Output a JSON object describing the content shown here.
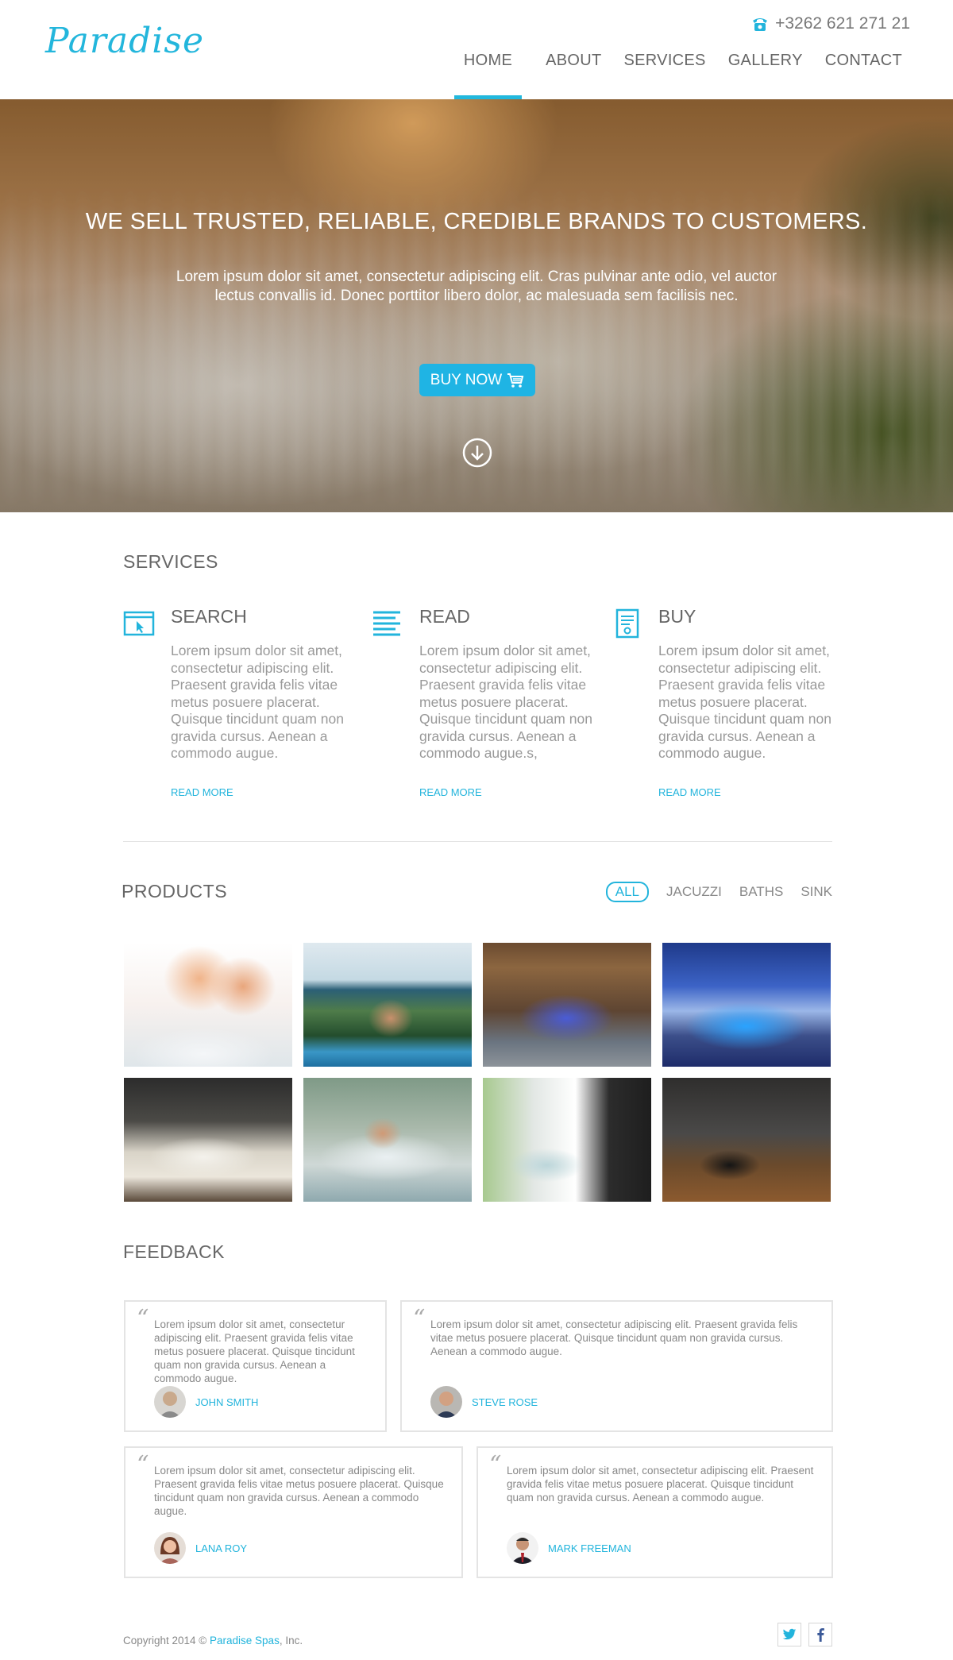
{
  "header": {
    "logo": "Paradise",
    "phone": "+3262 621 271 21",
    "nav": [
      "HOME",
      "ABOUT",
      "SERVICES",
      "GALLERY",
      "CONTACT"
    ]
  },
  "hero": {
    "title": "WE SELL TRUSTED, RELIABLE, CREDIBLE BRANDS TO CUSTOMERS.",
    "text": "Lorem ipsum dolor sit amet, consectetur adipiscing elit. Cras pulvinar ante odio, vel auctor lectus convallis id. Donec porttitor libero dolor, ac malesuada sem facilisis nec.",
    "button": "BUY NOW"
  },
  "services": {
    "title": "SERVICES",
    "items": [
      {
        "head": "SEARCH",
        "text": "Lorem ipsum dolor sit amet, consectetur adipiscing elit. Praesent gravida felis vitae metus posuere placerat. Quisque tincidunt quam non gravida cursus. Aenean a commodo augue.",
        "link": "READ MORE"
      },
      {
        "head": "READ",
        "text": "Lorem ipsum dolor sit amet, consectetur adipiscing elit. Praesent gravida felis vitae metus posuere placerat. Quisque tincidunt quam non gravida cursus. Aenean a commodo augue.s,",
        "link": "READ MORE"
      },
      {
        "head": "BUY",
        "text": "Lorem ipsum dolor sit amet, consectetur adipiscing elit. Praesent gravida felis vitae metus posuere placerat. Quisque tincidunt quam non gravida cursus. Aenean a commodo augue.",
        "link": "READ MORE"
      }
    ]
  },
  "products": {
    "title": "PRODUCTS",
    "filters": [
      "ALL",
      "JACUZZI",
      "BATHS",
      "SINK"
    ]
  },
  "feedback": {
    "title": "FEEDBACK",
    "cards": [
      {
        "text": "Lorem ipsum dolor sit amet, consectetur adipiscing elit. Praesent gravida felis vitae metus posuere placerat. Quisque tincidunt quam non gravida cursus. Aenean a commodo augue.",
        "name": "JOHN SMITH"
      },
      {
        "text": "Lorem ipsum dolor sit amet, consectetur adipiscing elit. Praesent gravida felis vitae metus posuere placerat. Quisque tincidunt quam non gravida cursus. Aenean a commodo augue.",
        "name": "STEVE ROSE"
      },
      {
        "text": "Lorem ipsum dolor sit amet, consectetur adipiscing elit. Praesent gravida felis vitae metus posuere placerat. Quisque tincidunt quam non gravida cursus. Aenean a commodo augue.",
        "name": "LANA ROY"
      },
      {
        "text": "Lorem ipsum dolor sit amet, consectetur adipiscing elit. Praesent gravida felis vitae metus posuere placerat. Quisque tincidunt quam non gravida cursus. Aenean a commodo augue.",
        "name": "MARK FREEMAN"
      }
    ]
  },
  "footer": {
    "copyright_prefix": "Copyright 2014 © ",
    "brand": "Paradise Spas",
    "copyright_suffix": ", Inc."
  },
  "colors": {
    "accent": "#22b4dc",
    "button": "#1fb4e4",
    "text_muted": "#999999"
  },
  "icons": [
    "phone-icon",
    "cart-icon",
    "arrow-down-circle-icon",
    "browser-cursor-icon",
    "text-lines-icon",
    "document-icon",
    "twitter-icon",
    "facebook-icon"
  ]
}
